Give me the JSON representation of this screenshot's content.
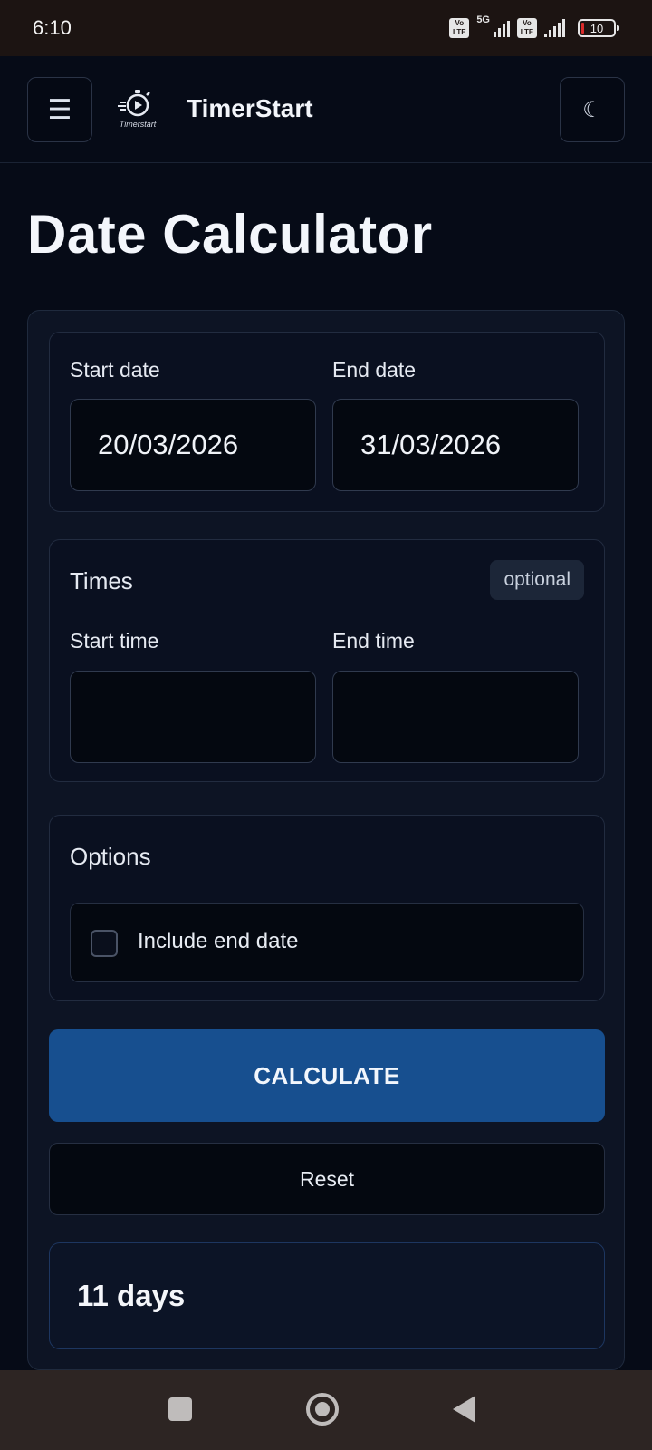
{
  "status_bar": {
    "time": "6:10",
    "network_label": "5G",
    "volte_label_1": "Vo LTE",
    "volte_label_2": "Vo LTE",
    "battery_level": "10"
  },
  "header": {
    "app_title": "TimerStart",
    "logo_text": "Timerstart",
    "menu_icon": "hamburger-menu-icon",
    "theme_icon": "moon-icon"
  },
  "page": {
    "title": "Date Calculator"
  },
  "dates": {
    "start_label": "Start date",
    "start_value": "20/03/2026",
    "end_label": "End date",
    "end_value": "31/03/2026"
  },
  "times": {
    "section_title": "Times",
    "badge": "optional",
    "start_label": "Start time",
    "start_value": "",
    "end_label": "End time",
    "end_value": ""
  },
  "options": {
    "section_title": "Options",
    "include_end_date_label": "Include end date",
    "include_end_date_checked": false
  },
  "actions": {
    "calculate_label": "CALCULATE",
    "reset_label": "Reset"
  },
  "result": {
    "text": "11 days"
  },
  "colors": {
    "background": "#060b17",
    "primary_button": "#174f8f",
    "card": "#0d1424"
  }
}
